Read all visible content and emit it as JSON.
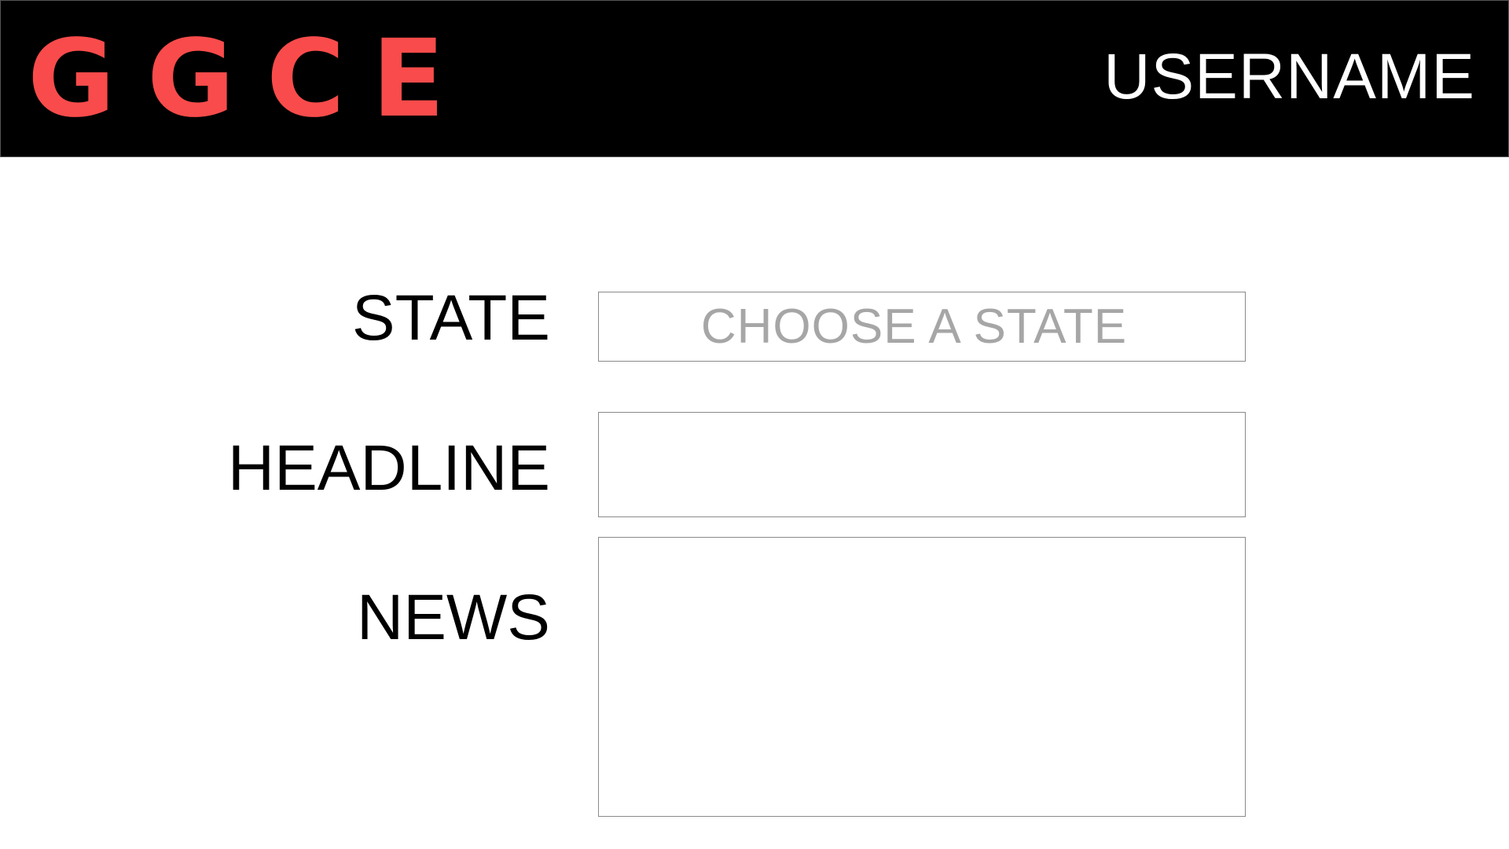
{
  "header": {
    "logo_letters": [
      "G",
      "G",
      "C",
      "E"
    ],
    "username": "USERNAME"
  },
  "form": {
    "state": {
      "label": "STATE",
      "placeholder": "CHOOSE A STATE",
      "value": ""
    },
    "headline": {
      "label": "HEADLINE",
      "value": ""
    },
    "news": {
      "label": "NEWS",
      "value": ""
    }
  },
  "colors": {
    "header_bg": "#000000",
    "logo": "#f94b4b",
    "username": "#ffffff",
    "placeholder": "#a6a6a6",
    "field_border": "#8a8a8a"
  }
}
